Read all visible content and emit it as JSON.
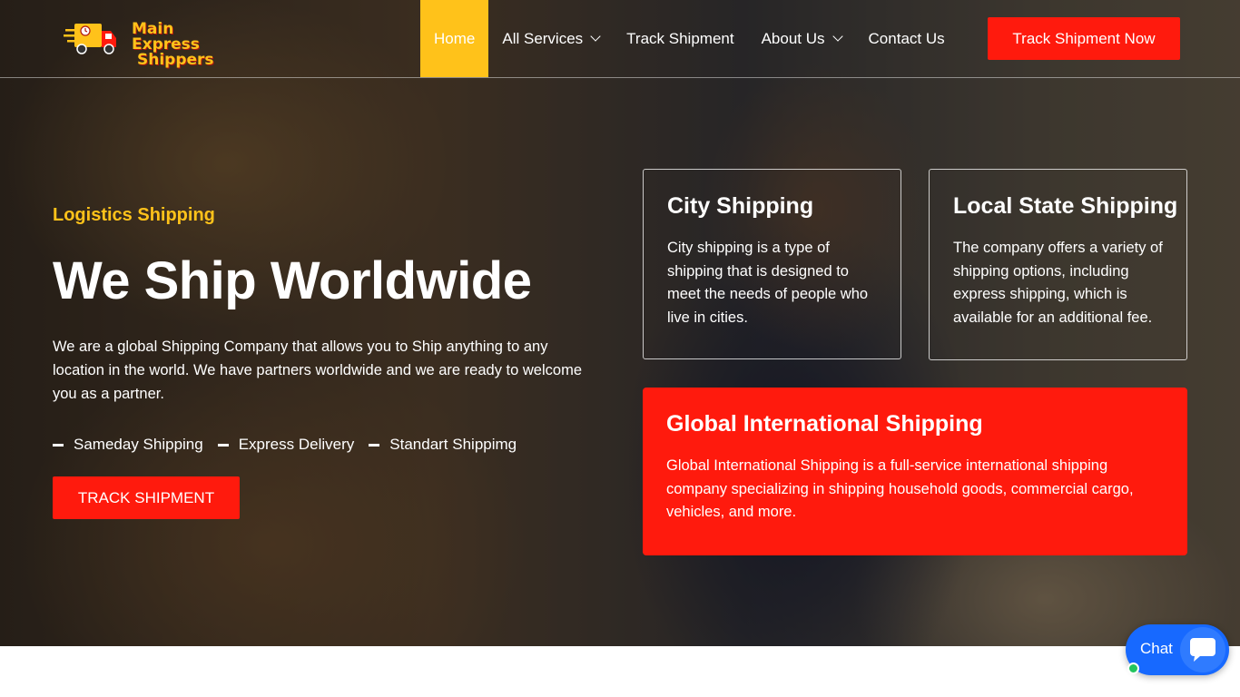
{
  "brand": {
    "name_line1": "Main Express",
    "name_line2": "Shippers",
    "color_yellow": "#ffc21a",
    "color_red": "#ff1a0d"
  },
  "nav": {
    "items": [
      {
        "label": "Home",
        "active": true
      },
      {
        "label": "All Services",
        "dropdown": true
      },
      {
        "label": "Track Shipment"
      },
      {
        "label": "About Us",
        "dropdown": true
      },
      {
        "label": "Contact Us"
      }
    ],
    "cta": "Track Shipment Now"
  },
  "hero": {
    "tagline": "Logistics Shipping",
    "headline": "We Ship Worldwide",
    "intro": "We are a global Shipping Company that allows you to Ship anything to any location in the world. We have partners worldwide and we are ready to welcome you as a partner.",
    "features": [
      "Sameday Shipping",
      "Express Delivery",
      "Standart Shippimg"
    ],
    "cta": "TRACK SHIPMENT"
  },
  "services": [
    {
      "title": "City Shipping",
      "text": "City shipping is a type of shipping that is designed to meet the needs of people who live in cities."
    },
    {
      "title": "Local State Shipping",
      "text": "The company offers a variety of shipping options, including express shipping, which is available for an additional fee."
    },
    {
      "title": "Global International Shipping",
      "text": "Global International Shipping is a full-service international shipping company specializing in shipping household goods, commercial cargo, vehicles, and more."
    }
  ],
  "chat": {
    "label": "Chat",
    "icon": "chat-bubble-icon",
    "status": "online"
  }
}
